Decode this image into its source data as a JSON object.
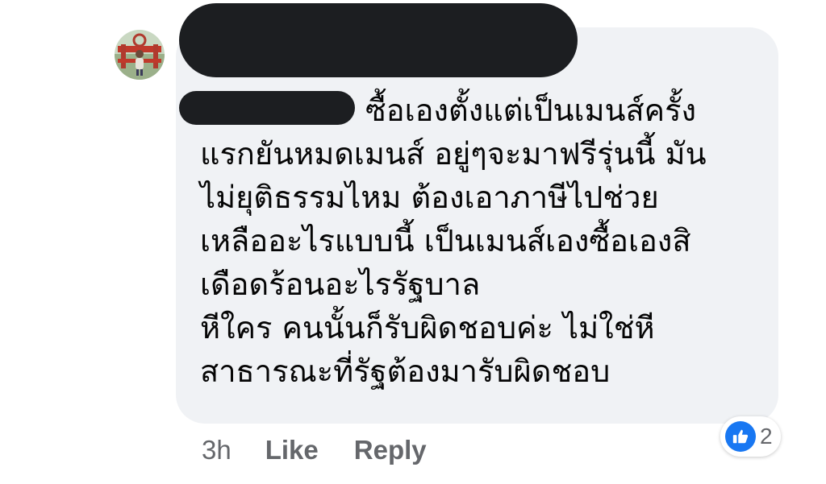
{
  "comment": {
    "lines": [
      "ซื้อเองตั้งแต่เป็นเมนส์ครั้ง",
      "แรกยันหมดเมนส์ อยู่ๆจะมาฟรีรุ่นนี้ มัน",
      "ไม่ยุติธรรมไหม ต้องเอาภาษีไปช่วย",
      "เหลืออะไรแบบนี้ เป็นเมนส์เองซื้อเองสิ",
      "เดือดร้อนอะไรรัฐบาล",
      "หีใคร คนนั้นก็รับผิดชอบค่ะ ไม่ใช่หี",
      "สาธารณะที่รัฐต้องมารับผิดชอบ"
    ]
  },
  "actions": {
    "time": "3h",
    "like_label": "Like",
    "reply_label": "Reply"
  },
  "reactions": {
    "icon": "thumbs-up-icon",
    "count": "2"
  },
  "colors": {
    "bubble": "#f0f2f5",
    "text": "#050505",
    "secondary_text": "#65676b",
    "like_blue": "#1877f2",
    "redaction": "#1c1e21"
  }
}
